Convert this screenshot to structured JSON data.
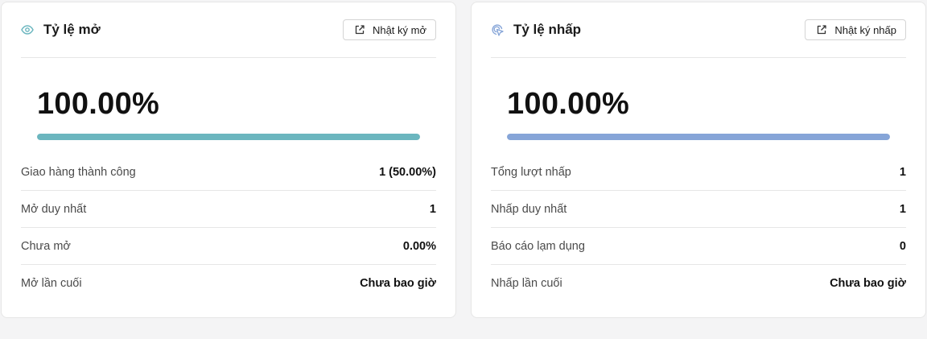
{
  "colors": {
    "open_accent": "#6bb6bf",
    "click_accent": "#86a5d8"
  },
  "open_card": {
    "icon": "eye-icon",
    "title": "Tỷ lệ mở",
    "log_button_label": "Nhật ký mở",
    "log_button_icon": "external-link-icon",
    "rate_text": "100.00%",
    "rate_fraction": 1.0,
    "stats": [
      {
        "label": "Giao hàng thành công",
        "value": "1 (50.00%)"
      },
      {
        "label": "Mở duy nhất",
        "value": "1"
      },
      {
        "label": "Chưa mở",
        "value": "0.00%"
      },
      {
        "label": "Mở lần cuối",
        "value": "Chưa bao giờ"
      }
    ]
  },
  "click_card": {
    "icon": "cursor-click-icon",
    "title": "Tỷ lệ nhấp",
    "log_button_label": "Nhật ký nhấp",
    "log_button_icon": "external-link-icon",
    "rate_text": "100.00%",
    "rate_fraction": 1.0,
    "stats": [
      {
        "label": "Tổng lượt nhấp",
        "value": "1"
      },
      {
        "label": "Nhấp duy nhất",
        "value": "1"
      },
      {
        "label": "Báo cáo lạm dụng",
        "value": "0"
      },
      {
        "label": "Nhấp lần cuối",
        "value": "Chưa bao giờ"
      }
    ]
  }
}
